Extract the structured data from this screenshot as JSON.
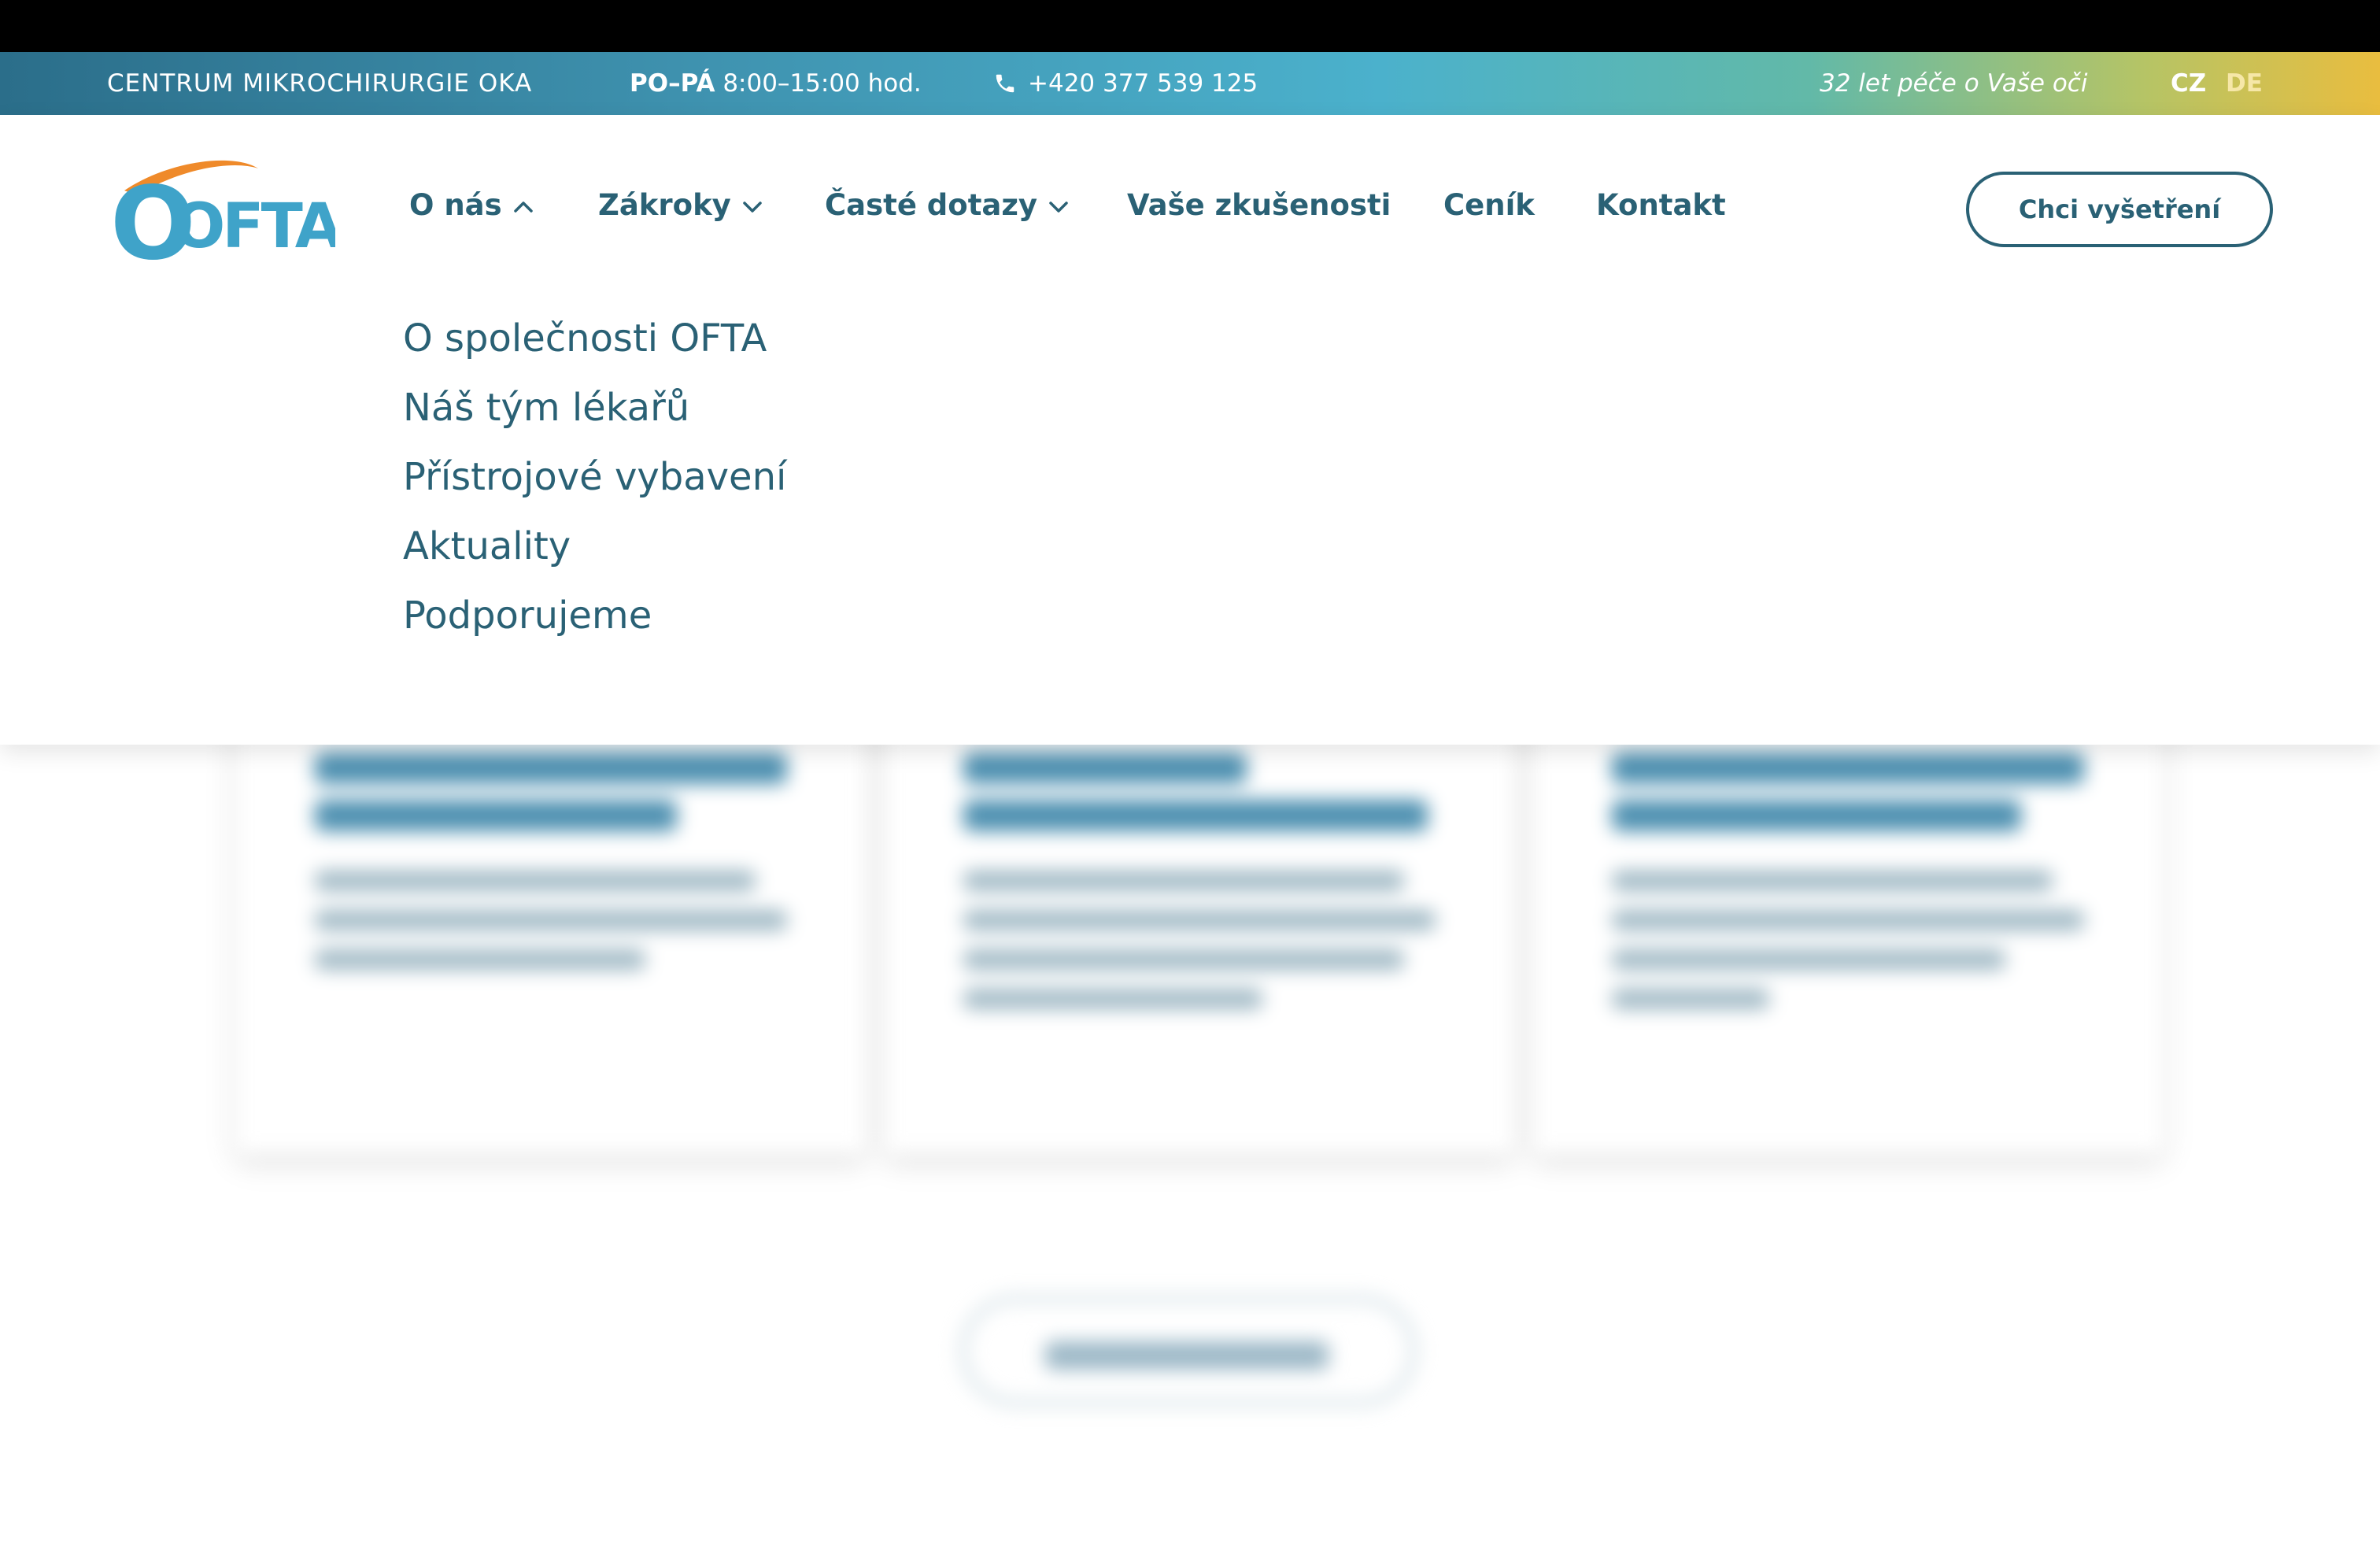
{
  "topbar": {
    "center_name": "CENTRUM MIKROCHIRURGIE OKA",
    "hours_days": "PO–PÁ",
    "hours_time": "8:00–15:00 hod.",
    "phone": "+420 377 539 125",
    "tagline": "32 let péče o Vaše oči",
    "lang_cz": "CZ",
    "lang_de": "DE"
  },
  "logo": {
    "text": "OFTA"
  },
  "nav": {
    "onas": "O nás",
    "zakroky": "Zákroky",
    "dotazy": "Časté dotazy",
    "zkusenosti": "Vaše zkušenosti",
    "cenik": "Ceník",
    "kontakt": "Kontakt"
  },
  "cta": {
    "label": "Chci vyšetření"
  },
  "dropdown": {
    "items": [
      {
        "label": "O společnosti OFTA"
      },
      {
        "label": "Náš tým lékařů"
      },
      {
        "label": "Přístrojové vybavení"
      },
      {
        "label": "Aktuality"
      },
      {
        "label": "Podporujeme"
      }
    ]
  },
  "colors": {
    "primary_text": "#2a6175",
    "logo_blue": "#3fa3c9",
    "logo_orange": "#ef8a2a",
    "topbar_start": "#2b6e8a",
    "topbar_end": "#e9bd3f"
  }
}
